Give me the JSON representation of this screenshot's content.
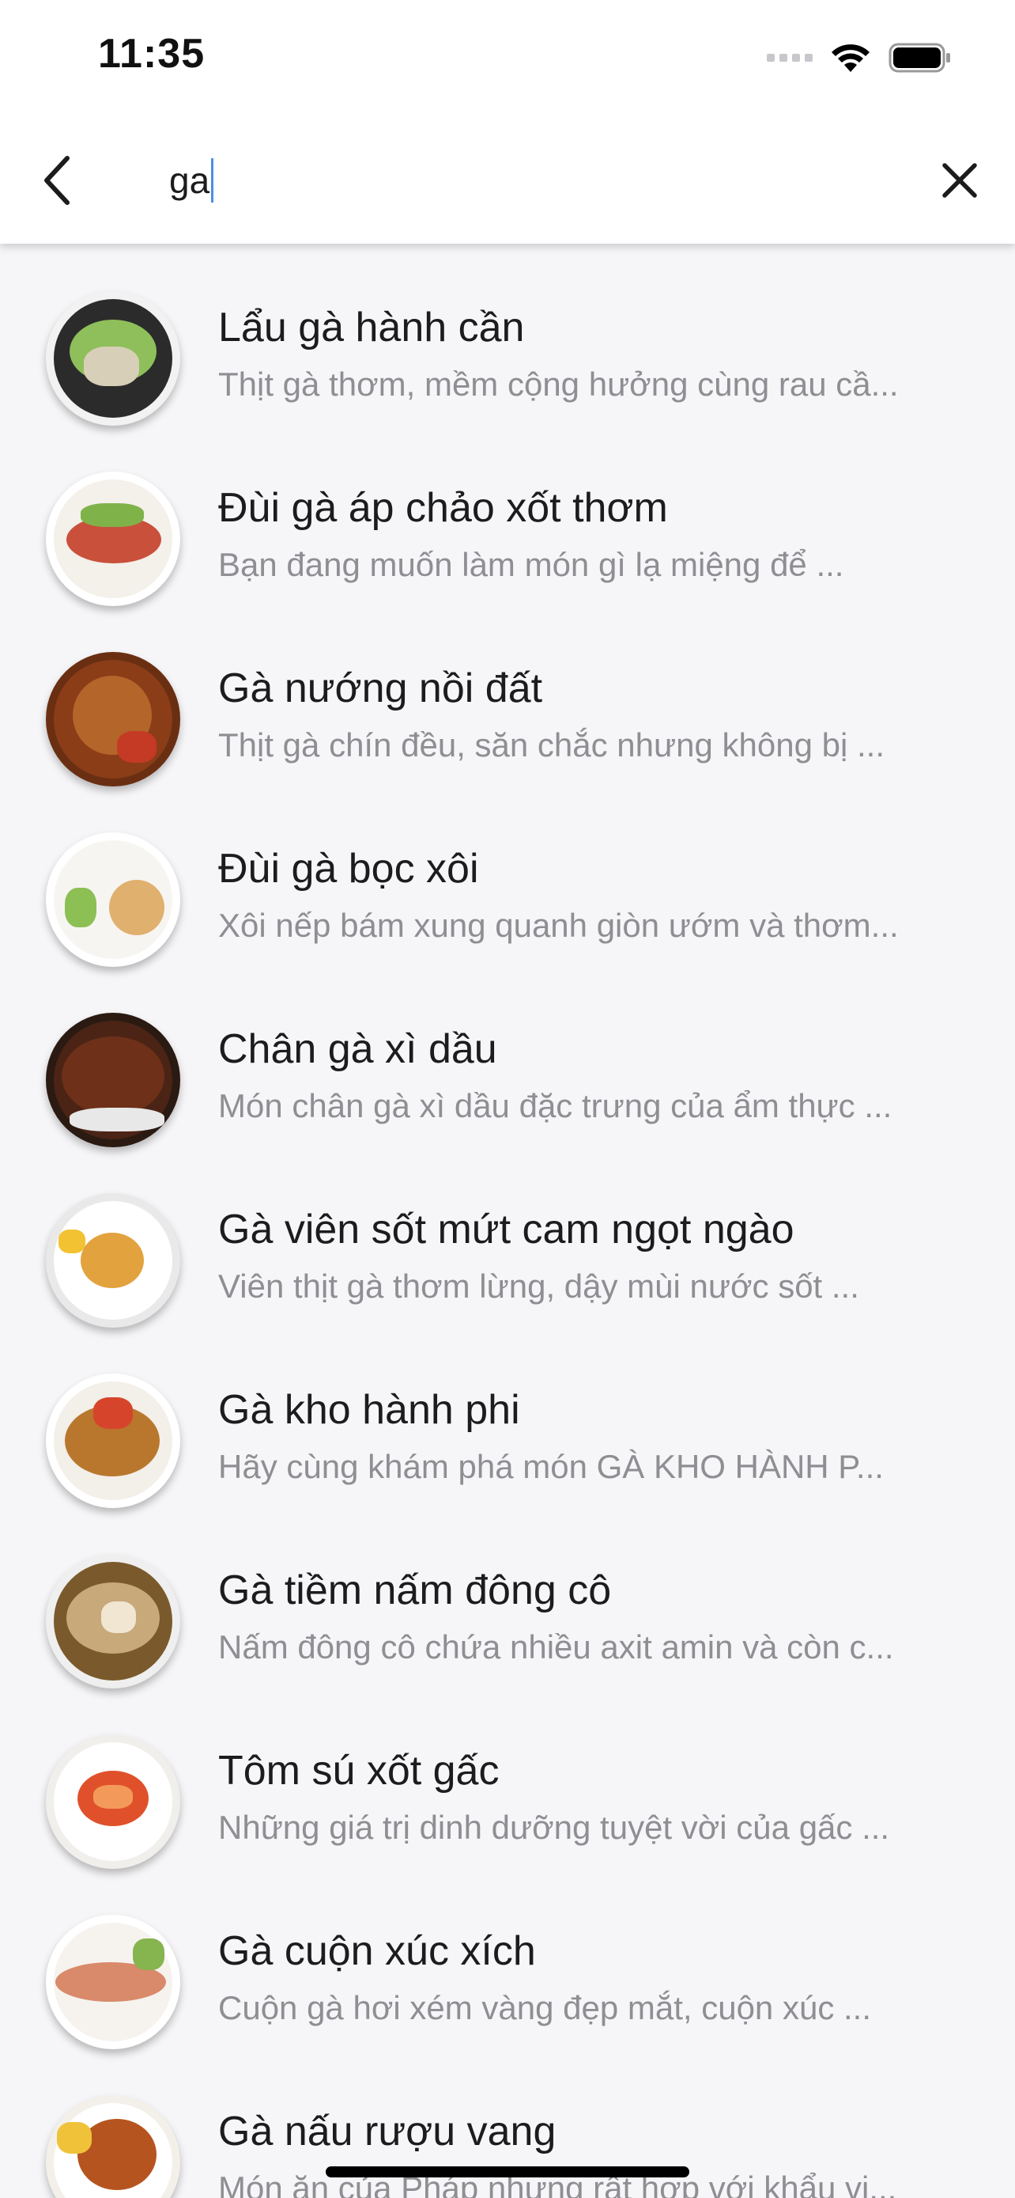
{
  "status": {
    "time": "11:35"
  },
  "search": {
    "query": "ga"
  },
  "icons": {
    "back": "chevron-left-icon",
    "clear": "close-icon",
    "signal": "signal-icon",
    "wifi": "wifi-icon",
    "battery": "battery-icon"
  },
  "results": [
    {
      "title": "Lẩu gà hành cần",
      "desc": "Thịt gà thơm, mềm cộng hưởng cùng rau cầ..."
    },
    {
      "title": "Đùi gà áp chảo xốt thơm",
      "desc": "Bạn đang muốn làm món gì lạ miệng để ..."
    },
    {
      "title": "Gà nướng nồi đất",
      "desc": "Thịt gà chín đều, săn chắc nhưng không bị ..."
    },
    {
      "title": "Đùi gà bọc xôi",
      "desc": "Xôi nếp bám xung quanh giòn ướm và thơm..."
    },
    {
      "title": "Chân gà xì dầu",
      "desc": "Món chân gà xì dầu đặc trưng của ẩm thực ..."
    },
    {
      "title": "Gà viên sốt mứt cam ngọt ngào",
      "desc": "Viên thịt gà thơm lừng, dậy mùi nước sốt ..."
    },
    {
      "title": "Gà kho hành phi",
      "desc": "Hãy cùng khám phá món GÀ KHO HÀNH P..."
    },
    {
      "title": "Gà tiềm nấm đông cô",
      "desc": "Nấm đông cô chứa nhiều axit amin và còn c..."
    },
    {
      "title": "Tôm sú xốt gấc",
      "desc": "Những giá trị dinh dưỡng tuyệt vời của gấc ..."
    },
    {
      "title": "Gà cuộn xúc xích",
      "desc": "Cuộn gà hơi xém vàng đẹp mắt, cuộn xúc ..."
    },
    {
      "title": "Gà nấu rượu vang",
      "desc": "Món ăn của Pháp nhưng rất hợp với khẩu vị..."
    }
  ]
}
